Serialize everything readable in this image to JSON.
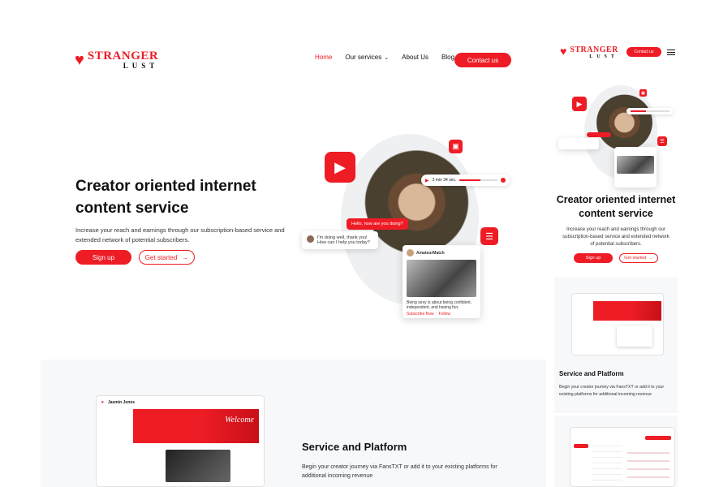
{
  "brand": {
    "line1": "STRANGER",
    "line2": "LUST"
  },
  "nav": {
    "home": "Home",
    "services": "Our services",
    "about": "About Us",
    "blog": "Blog",
    "contact": "Contact us"
  },
  "hero": {
    "title": "Creator oriented internet content service",
    "subtitle": "Increase your reach and earnings through our subscription-based service and extended network of potential subscribers.",
    "signup": "Sign up",
    "get_started": "Get started",
    "chat_question": "Hello, how are you doing?",
    "chat_answer": "I'm doing well, thank you! How can I help you today?",
    "audio_time": "3 min 34 sec.",
    "card_user": "AmateurMatch",
    "card_text": "Being sexy is about being confident, independent, and having fun.",
    "card_link1": "Subscribe Now",
    "card_link2": "Follow"
  },
  "service": {
    "title": "Service and Platform",
    "subtitle": "Begin your creator journey via FansTXT or add it to your existing platforms for additional incoming revenue",
    "mock_user": "Jasmin Jones",
    "mock_welcome": "Welcome"
  },
  "mobile": {
    "contact": "Contact us",
    "title": "Creator oriented internet content service",
    "subtitle": "Increase your reach and earnings through our subscription-based service and extended network of potential subscribers.",
    "signup": "Sign up",
    "get_started": "Get started",
    "service_title": "Service and Platform",
    "service_sub": "Begin your creator journey via FansTXT or add it to your existing platforms for additional incoming revenue"
  },
  "colors": {
    "accent": "#ee1c25",
    "panel": "#f7f8fa"
  },
  "icons": [
    "heart-logo-icon",
    "chevron-down-icon",
    "arrow-right-icon",
    "video-icon",
    "image-icon",
    "sliders-icon",
    "play-icon",
    "hamburger-icon"
  ]
}
